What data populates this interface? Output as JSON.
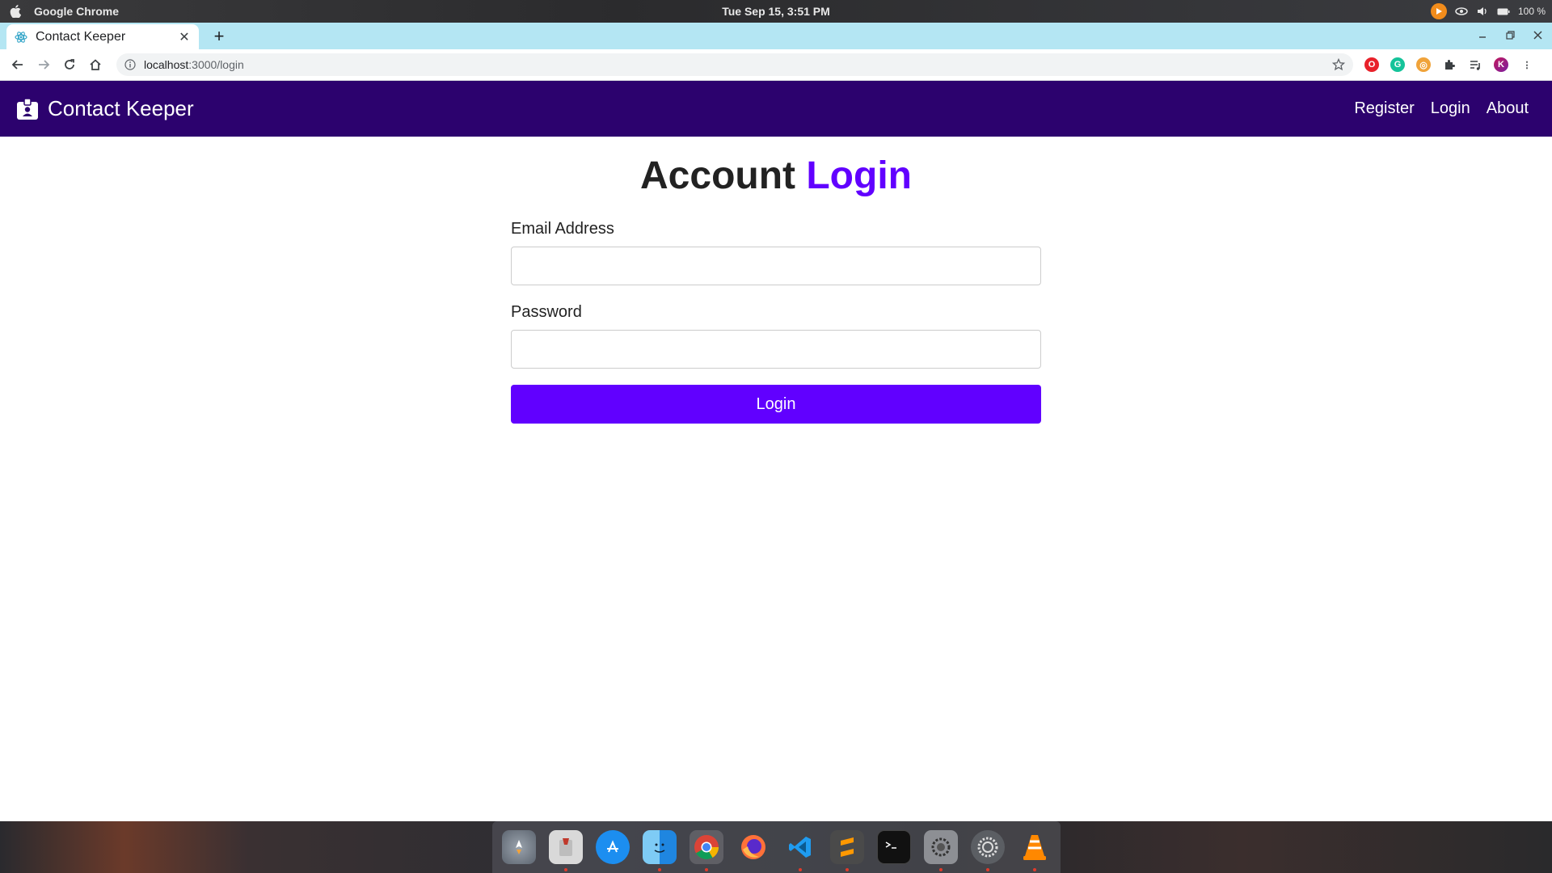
{
  "os_bar": {
    "app_name": "Google Chrome",
    "clock": "Tue Sep 15,  3:51 PM",
    "battery": "100 %"
  },
  "browser": {
    "tab_title": "Contact Keeper",
    "url_host": "localhost",
    "url_path": ":3000/login",
    "icons": {
      "back": "arrow-left-icon",
      "forward": "arrow-right-icon",
      "reload": "reload-icon",
      "home": "home-icon",
      "star": "star-icon"
    }
  },
  "navbar": {
    "brand_title": "Contact Keeper",
    "brand_icon": "id-badge-icon",
    "links": [
      "Register",
      "Login",
      "About"
    ],
    "background": "#2c026e"
  },
  "login": {
    "title_plain": "Account",
    "title_accent": "Login",
    "email_label": "Email Address",
    "email_value": "",
    "password_label": "Password",
    "password_value": "",
    "submit_label": "Login",
    "accent_color": "#6100ff"
  },
  "dock": {
    "apps": [
      "launchpad-icon",
      "script-editor-icon",
      "app-store-icon",
      "finder-icon",
      "chrome-icon",
      "firefox-icon",
      "vscode-icon",
      "sublime-text-icon",
      "terminal-icon",
      "utilities-icon",
      "system-preferences-icon",
      "vlc-icon"
    ]
  }
}
